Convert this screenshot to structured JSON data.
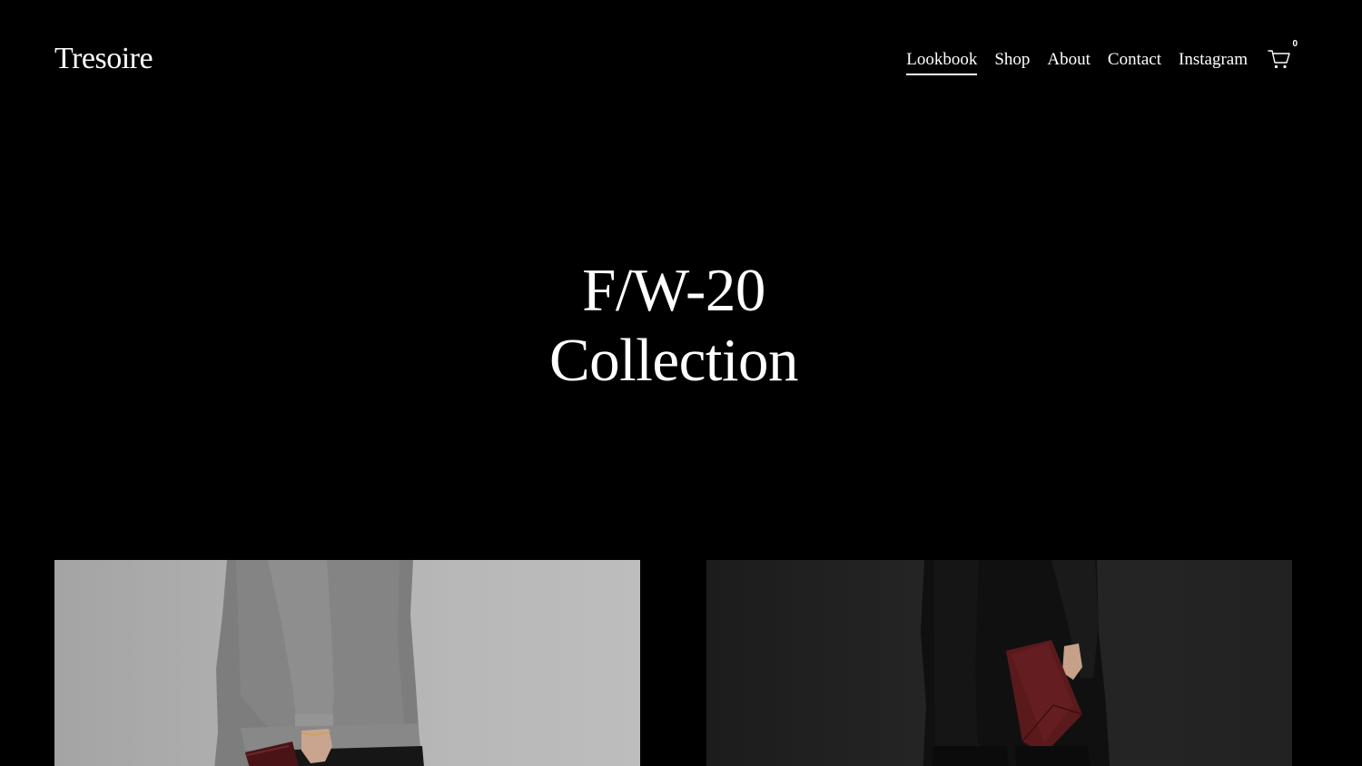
{
  "brand": {
    "name": "Tresoire"
  },
  "nav": {
    "items": [
      {
        "label": "Lookbook",
        "active": true
      },
      {
        "label": "Shop",
        "active": false
      },
      {
        "label": "About",
        "active": false
      },
      {
        "label": "Contact",
        "active": false
      },
      {
        "label": "Instagram",
        "active": false
      }
    ],
    "cart": {
      "icon": "cart-icon",
      "count": "0"
    }
  },
  "hero": {
    "line1": "F/W-20",
    "line2": "Collection"
  },
  "lookbook": {
    "images": [
      {
        "icon": "model-grey-sweater-photo"
      },
      {
        "icon": "model-black-coat-photo"
      }
    ]
  },
  "colors": {
    "background": "#000000",
    "text": "#ffffff",
    "accent_burgundy": "#5a1a1c"
  }
}
